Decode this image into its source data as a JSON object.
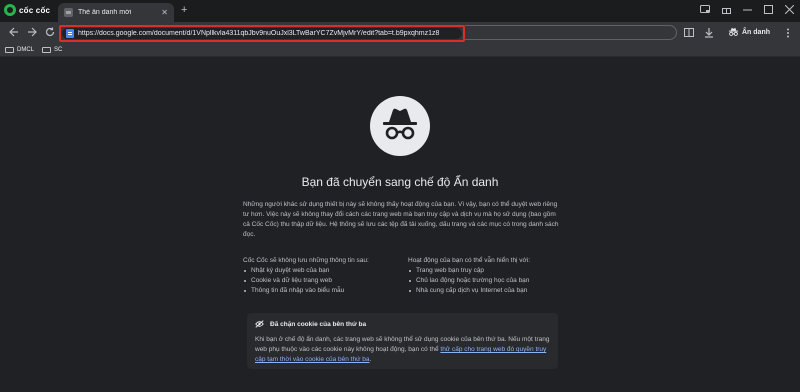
{
  "browser": {
    "brand": "cốc cốc",
    "tab_title": "Thẻ ẩn danh mới",
    "tab_close": "✕",
    "new_tab": "+",
    "url": "https://docs.google.com/document/d/1VNpllkvla4311qbJbv9nuOuJxl3LTwBarYC7ZvMjvMrY/edit?tab=t.b9pxqhmz1z8",
    "incognito_label": "Ẩn danh",
    "bookmarks": [
      "DMCL",
      "SC"
    ]
  },
  "page": {
    "title": "Bạn đã chuyển sang chế độ Ẩn danh",
    "description": "Những người khác sử dụng thiết bị này sẽ không thấy hoạt động của bạn. Vì vậy, bạn có thể duyệt web riêng tư hơn. Việc này sẽ không thay đổi cách các trang web mà bạn truy cập và dịch vụ mà họ sử dụng (bao gồm cả Cốc Cốc) thu thập dữ liệu. Hệ thống sẽ lưu các tệp đã tải xuống, dấu trang và các mục có trong danh sách đọc.",
    "left_heading": "Cốc Cốc sẽ không lưu những thông tin sau:",
    "left_items": [
      "Nhật ký duyệt web của bạn",
      "Cookie và dữ liệu trang web",
      "Thông tin đã nhập vào biểu mẫu"
    ],
    "right_heading": "Hoạt động của bạn có thể vẫn hiển thị với:",
    "right_items": [
      "Trang web bạn truy cập",
      "Chủ lao động hoặc trường học của bạn",
      "Nhà cung cấp dịch vụ Internet của bạn"
    ],
    "cookie_title": "Đã chặn cookie của bên thứ ba",
    "cookie_text": "Khi bạn ở chế độ ẩn danh, các trang web sẽ không thể sử dụng cookie của bên thứ ba. Nếu một trang web phụ thuộc vào các cookie này không hoạt động, bạn có thể ",
    "cookie_link": "thử cấp cho trang web đó quyền truy cập tạm thời vào cookie của bên thứ ba",
    "cookie_end": "."
  },
  "colors": {
    "background": "#202124",
    "toolbar": "#35363a",
    "highlight_box": "#d93025",
    "link": "#8ab4f8",
    "brand_green": "#2bb24c"
  }
}
